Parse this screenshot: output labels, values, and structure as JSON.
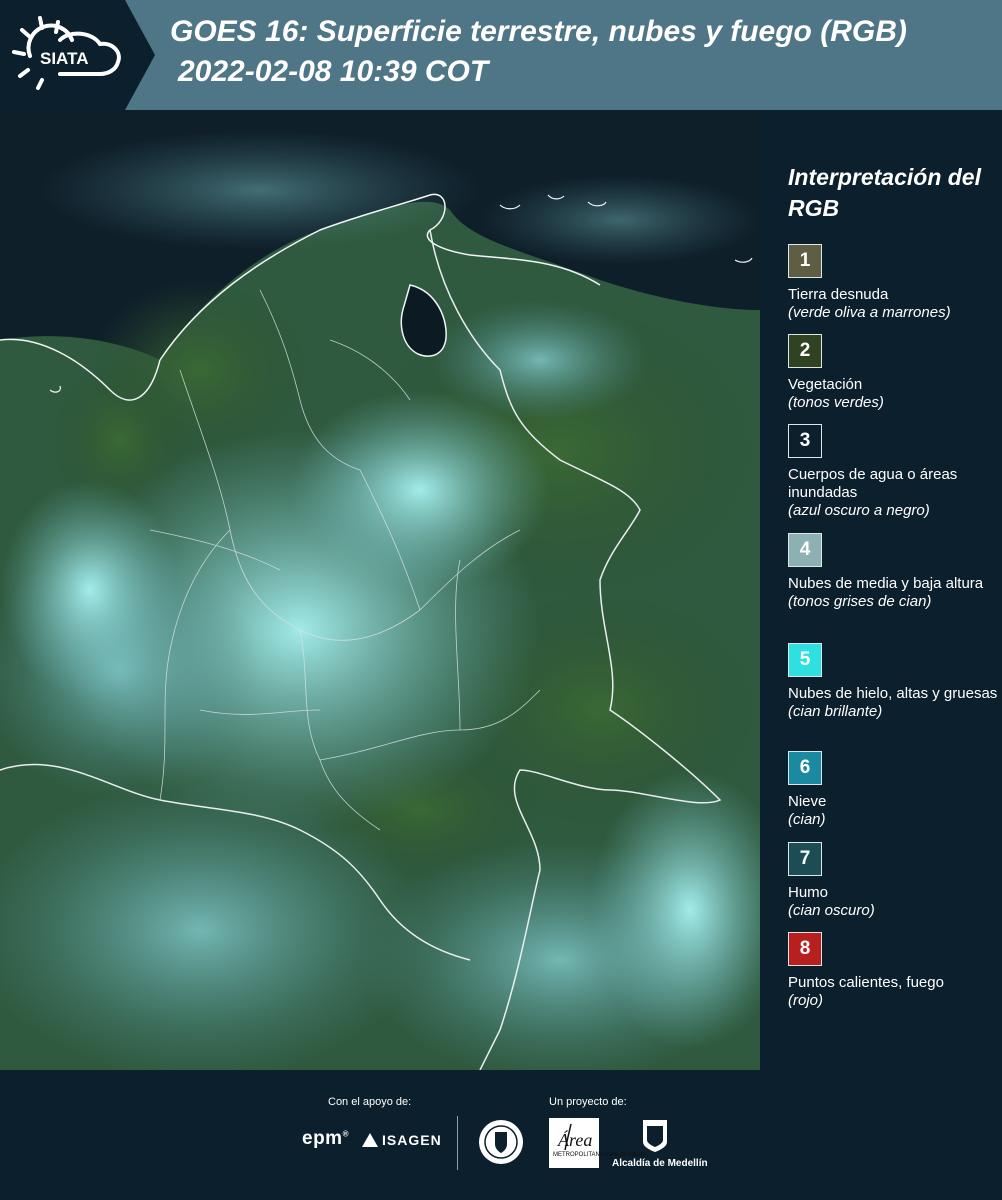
{
  "header": {
    "logo_text": "SIATA",
    "title": "GOES 16: Superficie terrestre, nubes y fuego (RGB)",
    "subtitle": "2022-02-08 10:39 COT"
  },
  "map": {
    "icon": "satellite-rgb-map-colombia",
    "colors": {
      "ocean": "#0d1c28",
      "vegetation": "#2f5a30",
      "cloud_low": "#6b9ea3",
      "cloud_ice": "#7fe6e8",
      "border": "#f2f5f6"
    }
  },
  "legend": {
    "title": "Interpretación del RGB",
    "items": [
      {
        "number": "1",
        "label": "Tierra desnuda",
        "note": "(verde oliva a marrones)",
        "color": "#5f5e45"
      },
      {
        "number": "2",
        "label": "Vegetación",
        "note": "(tonos verdes)",
        "color": "#2f4221"
      },
      {
        "number": "3",
        "label": "Cuerpos de agua o áreas inundadas",
        "note": "(azul oscuro a negro)",
        "color": "#0c1f2c"
      },
      {
        "number": "4",
        "label": "Nubes de media y baja altura",
        "note": "(tonos grises de cian)",
        "color": "#8db0b2"
      },
      {
        "number": "5",
        "label": "Nubes de hielo, altas y gruesas",
        "note": "(cian brillante)",
        "color": "#2fe0e0"
      },
      {
        "number": "6",
        "label": "Nieve",
        "note": "(cian)",
        "color": "#1b8aa0"
      },
      {
        "number": "7",
        "label": "Humo",
        "note": "(cian oscuro)",
        "color": "#1c4d55"
      },
      {
        "number": "8",
        "label": "Puntos calientes, fuego",
        "note": "(rojo)",
        "color": "#b82020"
      }
    ]
  },
  "footer": {
    "support_label": "Con el apoyo de:",
    "project_label": "Un proyecto de:",
    "sponsors": [
      "epm",
      "ISAGEN"
    ],
    "partners": [
      "Área Metropolitana Valle de Aburrá",
      "Alcaldía de Medellín"
    ],
    "area_logo_text": "Área",
    "area_logo_caption": "METROPOLITANA Valle de Aburrá",
    "medellin_label": "Alcaldía de Medellín"
  }
}
